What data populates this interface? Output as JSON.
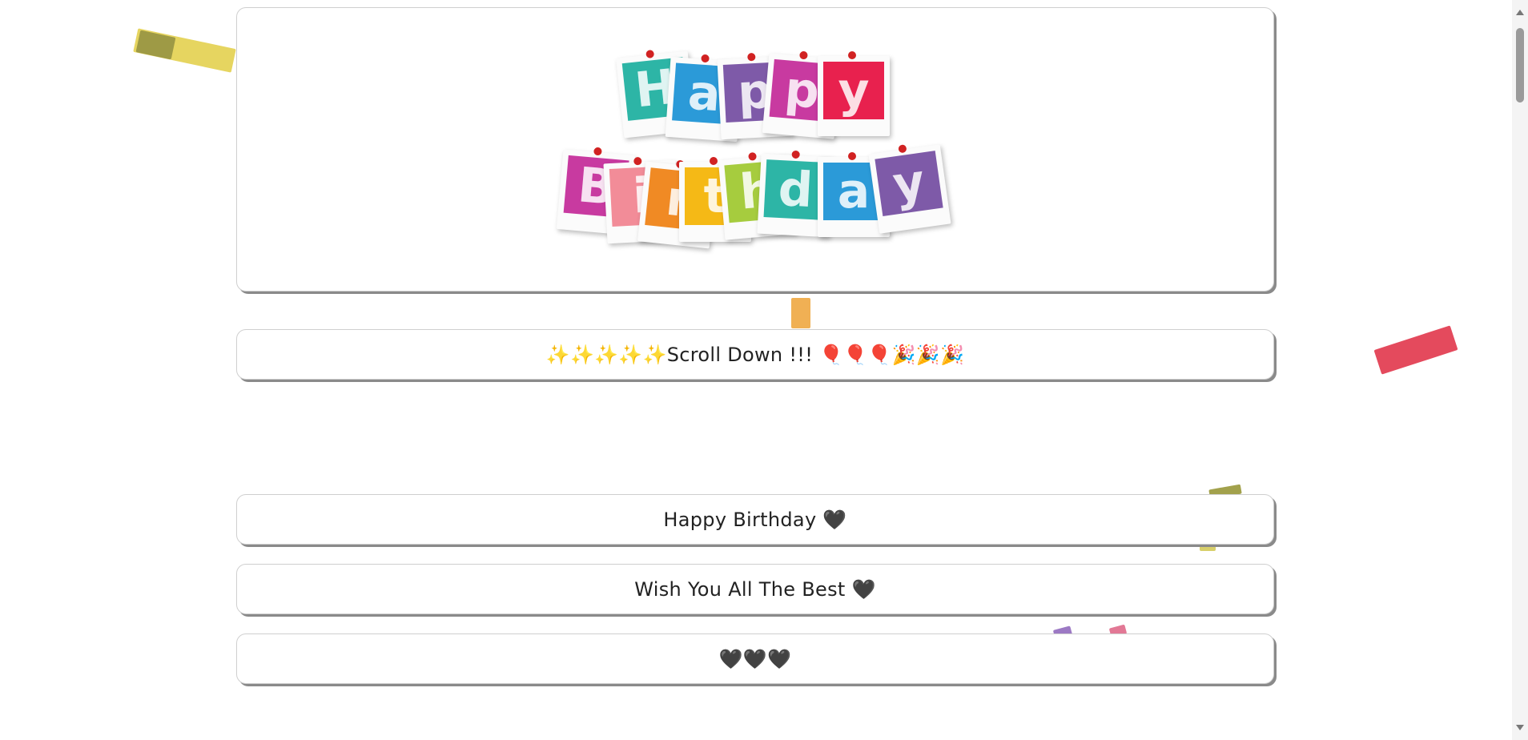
{
  "hero": {
    "image_alt": "Happy Birthday",
    "line1": [
      "H",
      "a",
      "p",
      "p",
      "y"
    ],
    "line2": [
      "B",
      "i",
      "r",
      "t",
      "h",
      "d",
      "a",
      "y"
    ]
  },
  "messages": {
    "scroll": "✨✨✨✨✨Scroll Down !!! 🎈🎈🎈🎉🎉🎉",
    "birthday": "Happy Birthday 🖤",
    "wish": "Wish You All The Best 🖤",
    "hearts": "🖤🖤🖤"
  },
  "colors": {
    "tile_teal": "#2db5a6",
    "tile_blue": "#2b9ad8",
    "tile_purple": "#7e5aa8",
    "tile_magenta": "#c83aa0",
    "tile_red": "#e8214e",
    "tile_pink": "#f28c98",
    "tile_orange": "#f08a24",
    "tile_yellow": "#f5b916",
    "tile_green": "#a6cc3e",
    "pin": "#d12222"
  }
}
